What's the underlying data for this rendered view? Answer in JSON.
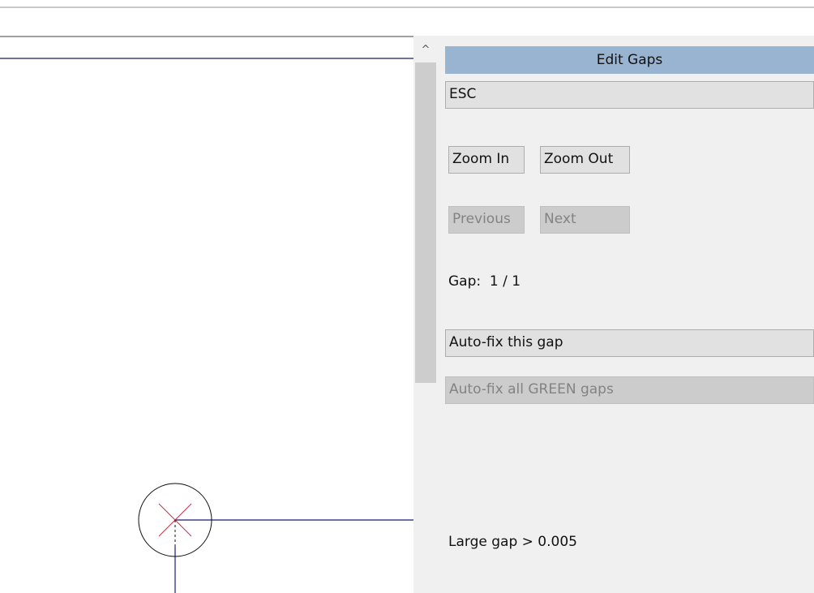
{
  "panel": {
    "title": "Edit Gaps",
    "esc_label": "ESC",
    "zoom_in_label": "Zoom In",
    "zoom_out_label": "Zoom Out",
    "previous_label": "Previous",
    "next_label": "Next",
    "gap_label": "Gap:",
    "gap_counter": "1 / 1",
    "autofix_gap_label": "Auto-fix this gap",
    "autofix_all_label": "Auto-fix all GREEN gaps",
    "large_gap_text": "Large gap > 0.005"
  },
  "scrollbar": {
    "up_arrow_glyph": "^"
  },
  "colors": {
    "title_bar": "#99b4d1",
    "line": "#1a1a6e",
    "marker_x": "#c0304a",
    "disabled_text": "#838383"
  },
  "icons": [
    "gap-marker-icon",
    "chevron-up-icon"
  ]
}
